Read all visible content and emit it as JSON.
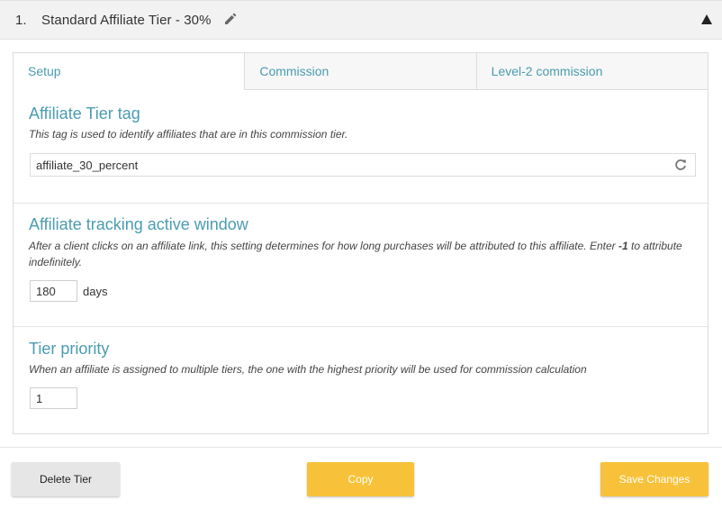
{
  "tier": {
    "number": "1.",
    "title": "Standard Affiliate Tier - 30%",
    "edit_icon": "pencil-icon",
    "collapse_icon": "triangle-up-icon"
  },
  "tabs": [
    {
      "label": "Setup",
      "active": true
    },
    {
      "label": "Commission",
      "active": false
    },
    {
      "label": "Level-2 commission",
      "active": false
    }
  ],
  "tag_section": {
    "title": "Affiliate Tier tag",
    "description": "This tag is used to identify affiliates that are in this commission tier.",
    "value": "affiliate_30_percent",
    "refresh_icon": "refresh-icon"
  },
  "window_section": {
    "title": "Affiliate tracking active window",
    "description_before": "After a client clicks on an affiliate link, this setting determines for how long purchases will be attributed to this affiliate. Enter ",
    "description_bold": "-1",
    "description_after": " to attribute indefinitely.",
    "value": "180",
    "unit": "days"
  },
  "priority_section": {
    "title": "Tier priority",
    "description": "When an affiliate is assigned to multiple tiers, the one with the highest priority will be used for commission calculation",
    "value": "1"
  },
  "buttons": {
    "delete": "Delete Tier",
    "copy": "Copy",
    "save": "Save Changes"
  },
  "colors": {
    "accent": "#4a9cb0",
    "button_primary": "#f7c23a",
    "button_secondary": "#e6e6e6",
    "header_bg": "#f2f2f2"
  }
}
